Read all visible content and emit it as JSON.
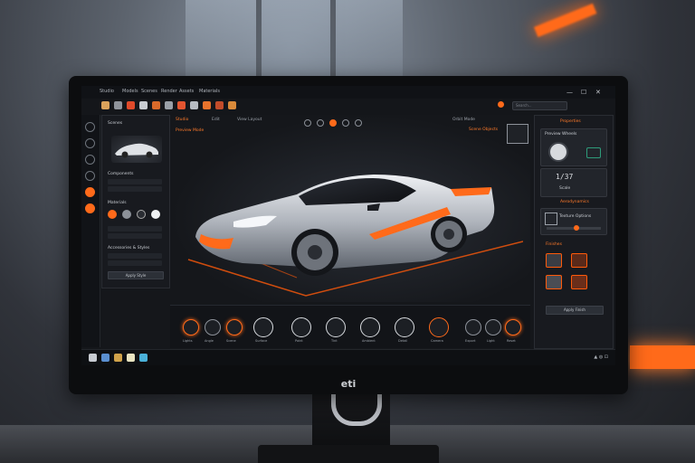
{
  "menu": {
    "items": [
      "Studio",
      "Models",
      "Scenes",
      "Render",
      "Assets",
      "Materials"
    ]
  },
  "toolbar": {
    "search_placeholder": "Search...",
    "window_controls": [
      "—",
      "☐",
      "✕"
    ]
  },
  "left_panel": {
    "title": "Scenes",
    "section_title": "Components",
    "section2_title": "Materials",
    "section3_title": "Accessories & Styles",
    "apply_button": "Apply Style"
  },
  "viewport": {
    "tabs": [
      "Studio",
      "Edit",
      "View Layout"
    ],
    "header_right": "Orbit Mode",
    "corner_label": "Preview Mode",
    "hud_label": "Scene Objects"
  },
  "right_panel": {
    "title": "Properties",
    "asset_title": "Preview Wheels",
    "readout": "1/37",
    "readout_label": "Scale",
    "section_title": "Aerodynamics",
    "texture_label": "Texture Options",
    "finish_title": "Finishes",
    "apply_button": "Apply Finish"
  },
  "bottom_tools": {
    "labels": [
      "Lights",
      "Angle",
      "Scene",
      "Surface",
      "Paint",
      "Tint",
      "Ambient",
      "Detail",
      "Camera",
      "Export",
      "Light",
      "Reset"
    ]
  },
  "monitor": {
    "brand": "eti"
  },
  "colors": {
    "accent": "#ff6a1a",
    "panel": "#181a1f",
    "screen_bg": "#15171b"
  }
}
